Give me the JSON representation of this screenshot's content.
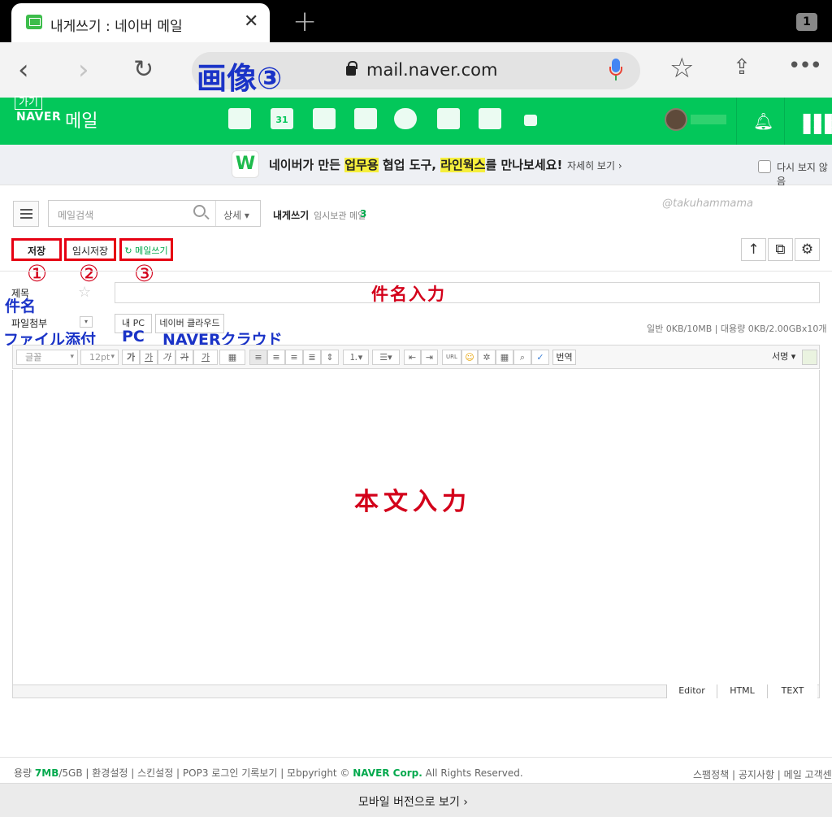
{
  "browser": {
    "tab_title": "내게쓰기 : 네이버 메일",
    "tab_count": "1",
    "url": "mail.naver.com",
    "annotation_image": "画像③"
  },
  "header": {
    "go_label": "가기",
    "logo_text": "NAVER",
    "logo_mail": "메일",
    "icons": [
      "mail-write-icon",
      "calendar-icon",
      "list-icon",
      "contacts-icon",
      "cloud-icon",
      "memo-icon",
      "works-icon",
      "more-icon"
    ],
    "calendar_day": "31",
    "accent": "#03c75a"
  },
  "banner": {
    "text_a": "네이버가 만든 ",
    "hl1": "업무용",
    "text_b": " 협업 도구, ",
    "hl2": "라인웍스",
    "text_c": "를 만나보세요!",
    "more": "자세히 보기 ›",
    "hide": "다시 보지 않음"
  },
  "toolbar": {
    "search_placeholder": "메일검색",
    "search_detail": "상세",
    "crumb_title": "내게쓰기",
    "crumb_temp": "임시보관 메일",
    "crumb_count": "3",
    "watermark": "@takuhammama"
  },
  "actions": {
    "save": "저장",
    "temp_save": "임시저장",
    "write_mail": "메일쓰기",
    "num1": "①",
    "num2": "②",
    "num3": "③"
  },
  "form": {
    "subject_label": "제목",
    "subject_anno": "件名",
    "subject_anno_input": "件名入力",
    "attach_label": "파일첨부",
    "attach_anno": "ファイル添付",
    "my_pc": "내 PC",
    "my_pc_anno": "PC",
    "cloud": "네이버 클라우드",
    "cloud_anno": "NAVERクラウド",
    "capacity": "일반 0KB/10MB  |  대용량 0KB/2.00GBx10개"
  },
  "editor": {
    "font": "글꼴",
    "size": "12pt",
    "bold": "가",
    "underline": "가",
    "italic": "가",
    "strike": "가",
    "color": "가",
    "url": "URL",
    "translate": "번역",
    "signature": "서명 ▾",
    "body_anno": "本文入力",
    "modes": [
      "Editor",
      "HTML",
      "TEXT"
    ]
  },
  "footer": {
    "usage_label": "용량",
    "usage_used": "7MB",
    "usage_total": "/5GB",
    "links": "  |  환경설정  |  스킨설정  |  POP3 로그인 기록보기  |  모",
    "copyright": "bpyright © ",
    "corp": "NAVER Corp.",
    "rights": " All Rights Reserved.",
    "right_links": "스팸정책  |  공지사항  |  메일 고객센터",
    "mobile": "모바일 버전으로 보기  ›"
  }
}
